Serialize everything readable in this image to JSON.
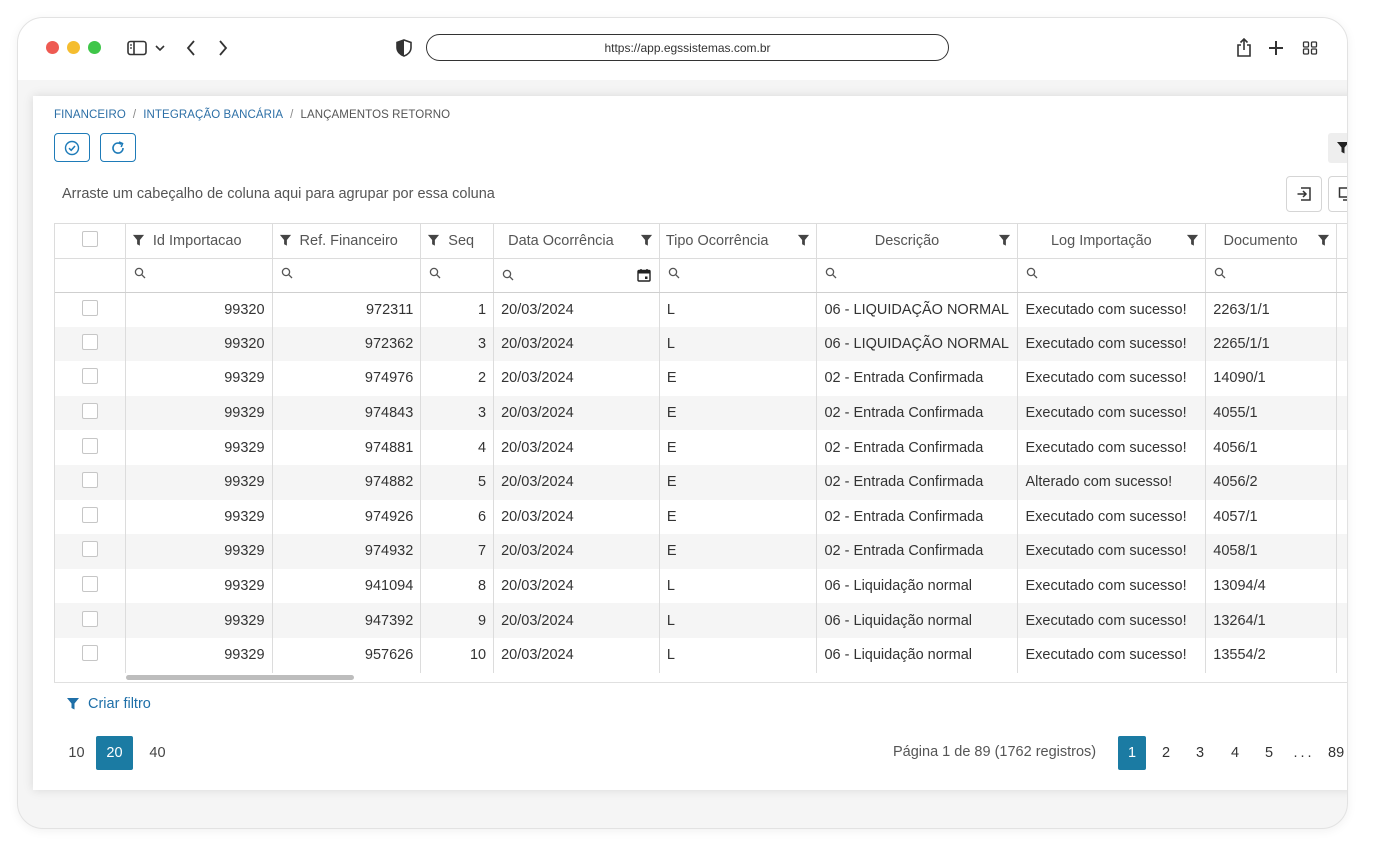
{
  "browser": {
    "url": "https://app.egssistemas.com.br"
  },
  "breadcrumb": {
    "item1": "FINANCEIRO",
    "item2": "INTEGRAÇÃO BANCÁRIA",
    "current": "LANÇAMENTOS RETORNO",
    "separator": "/"
  },
  "toolbar": {
    "group_hint": "Arraste um cabeçalho de coluna aqui para agrupar por essa coluna"
  },
  "columns": [
    "Id Importacao",
    "Ref. Financeiro",
    "Seq",
    "Data Ocorrência",
    "Tipo Ocorrência",
    "Descrição",
    "Log Importação",
    "Documento"
  ],
  "rows": [
    [
      "99320",
      "972311",
      "1",
      "20/03/2024",
      "L",
      "06 - LIQUIDAÇÃO NORMAL",
      "Executado com sucesso!",
      "2263/1/1"
    ],
    [
      "99320",
      "972362",
      "3",
      "20/03/2024",
      "L",
      "06 - LIQUIDAÇÃO NORMAL",
      "Executado com sucesso!",
      "2265/1/1"
    ],
    [
      "99329",
      "974976",
      "2",
      "20/03/2024",
      "E",
      "02 - Entrada Confirmada",
      "Executado com sucesso!",
      "14090/1"
    ],
    [
      "99329",
      "974843",
      "3",
      "20/03/2024",
      "E",
      "02 - Entrada Confirmada",
      "Executado com sucesso!",
      "4055/1"
    ],
    [
      "99329",
      "974881",
      "4",
      "20/03/2024",
      "E",
      "02 - Entrada Confirmada",
      "Executado com sucesso!",
      "4056/1"
    ],
    [
      "99329",
      "974882",
      "5",
      "20/03/2024",
      "E",
      "02 - Entrada Confirmada",
      "Alterado com sucesso!",
      "4056/2"
    ],
    [
      "99329",
      "974926",
      "6",
      "20/03/2024",
      "E",
      "02 - Entrada Confirmada",
      "Executado com sucesso!",
      "4057/1"
    ],
    [
      "99329",
      "974932",
      "7",
      "20/03/2024",
      "E",
      "02 - Entrada Confirmada",
      "Executado com sucesso!",
      "4058/1"
    ],
    [
      "99329",
      "941094",
      "8",
      "20/03/2024",
      "L",
      "06 - Liquidação normal",
      "Executado com sucesso!",
      "13094/4"
    ],
    [
      "99329",
      "947392",
      "9",
      "20/03/2024",
      "L",
      "06 - Liquidação normal",
      "Executado com sucesso!",
      "13264/1"
    ],
    [
      "99329",
      "957626",
      "10",
      "20/03/2024",
      "L",
      "06 - Liquidação normal",
      "Executado com sucesso!",
      "13554/2"
    ]
  ],
  "filter_bar": {
    "label": "Criar filtro"
  },
  "pager": {
    "page_sizes": [
      "10",
      "20",
      "40"
    ],
    "selected_size": "20",
    "info": "Página 1 de 89 (1762 registros)",
    "pages": [
      "1",
      "2",
      "3",
      "4",
      "5"
    ],
    "ellipsis": "...",
    "last_page": "89",
    "current_page": "1"
  },
  "colors": {
    "accent": "#1b7ba3",
    "link": "#2c6fa6"
  }
}
